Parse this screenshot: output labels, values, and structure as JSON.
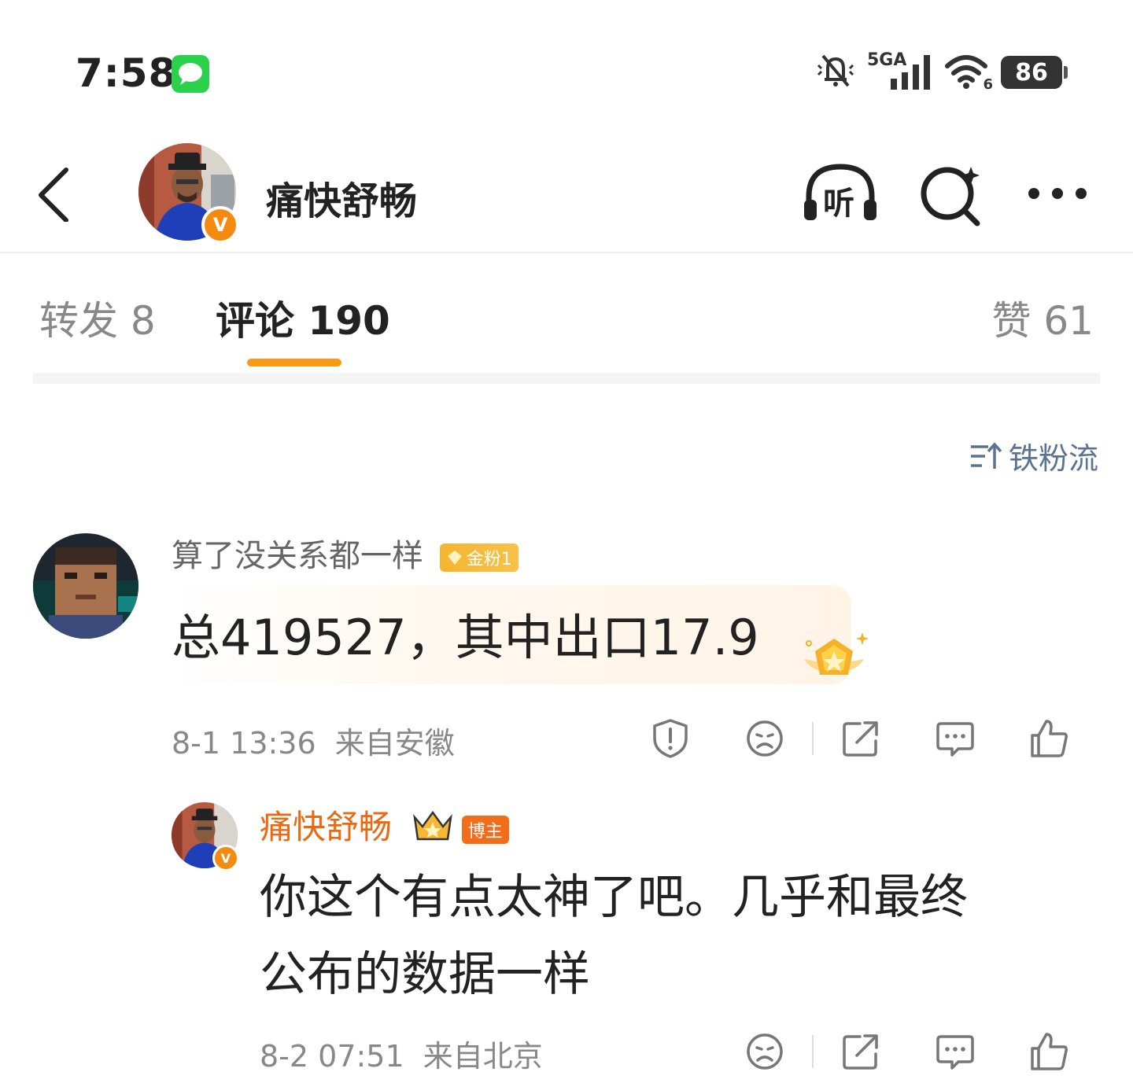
{
  "status_bar": {
    "time": "7:58",
    "network": "5GA",
    "wifi_label": "6",
    "battery": "86"
  },
  "header": {
    "title": "痛快舒畅",
    "listen_label": "听",
    "verified_badge": "V"
  },
  "tabs": {
    "repost": "转发 8",
    "comments": "评论 190",
    "likes": "赞 61"
  },
  "sort": {
    "label": "铁粉流"
  },
  "comments": [
    {
      "user": "算了没关系都一样",
      "badge": "金粉1",
      "text": "总419527，其中出口17.9",
      "time": "8-1 13:36",
      "location": "来自安徽"
    },
    {
      "user": "痛快舒畅",
      "badge": "博主",
      "text_line1": "你这个有点太神了吧。几乎和最终",
      "text_line2": "公布的数据一样",
      "time": "8-2 07:51",
      "location": "来自北京"
    }
  ],
  "colors": {
    "accent_orange": "#f99a16",
    "sort_blue": "#5b7392",
    "author_name": "#e86a12",
    "badge_gold": "#f7b733",
    "badge_orange": "#f36c1a"
  },
  "icons": {
    "message": "message-icon",
    "mute": "bell-muted-icon",
    "signal": "signal-icon",
    "wifi": "wifi-icon",
    "back": "chevron-left-icon",
    "listen": "headphones-icon",
    "search": "search-icon",
    "more": "more-icon",
    "sort": "sort-icon",
    "report": "shield-alert-icon",
    "dislike": "frown-icon",
    "share": "share-icon",
    "reply": "comment-icon",
    "like": "thumbs-up-icon"
  }
}
